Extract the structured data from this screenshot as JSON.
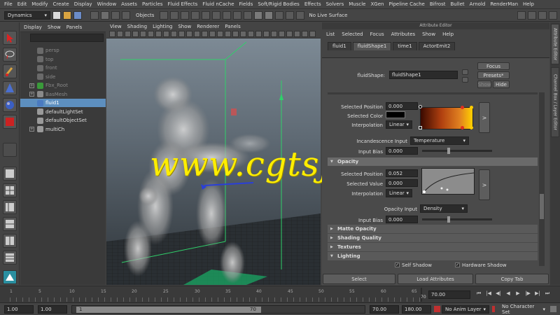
{
  "menubar": [
    "File",
    "Edit",
    "Modify",
    "Create",
    "Display",
    "Window",
    "Assets",
    "Particles",
    "Fluid Effects",
    "Fluid nCache",
    "Fields",
    "Soft/Rigid Bodies",
    "Effects",
    "Solvers",
    "Muscle",
    "XGen",
    "Pipeline Cache",
    "Bifrost",
    "Bullet",
    "Arnold",
    "RenderMan",
    "Help"
  ],
  "shelf": {
    "mode": "Dynamics",
    "objects_label": "Objects",
    "live_surface": "No Live Surface"
  },
  "outliner": {
    "menu": [
      "Display",
      "Show",
      "Panels"
    ],
    "items": [
      {
        "label": "persp",
        "dim": true,
        "expand": false
      },
      {
        "label": "top",
        "dim": true,
        "expand": false
      },
      {
        "label": "front",
        "dim": true,
        "expand": false
      },
      {
        "label": "side",
        "dim": true,
        "expand": false
      },
      {
        "label": "Fbx_Root",
        "dim": true,
        "expand": true
      },
      {
        "label": "BasMesh",
        "dim": true,
        "expand": true
      },
      {
        "label": "fluid1",
        "dim": false,
        "expand": false,
        "selected": true
      },
      {
        "label": "defaultLightSet",
        "dim": false,
        "expand": false
      },
      {
        "label": "defaultObjectSet",
        "dim": false,
        "expand": false
      },
      {
        "label": "multiCh",
        "dim": false,
        "expand": true
      }
    ]
  },
  "viewport": {
    "menu": [
      "View",
      "Shading",
      "Lighting",
      "Show",
      "Renderer",
      "Panels"
    ]
  },
  "attr_editor": {
    "title": "Attribute Editor",
    "menu": [
      "List",
      "Selected",
      "Focus",
      "Attributes",
      "Show",
      "Help"
    ],
    "tabs": [
      "fluid1",
      "fluidShape1",
      "time1",
      "ActorEmit2"
    ],
    "active_tab": 1,
    "shape_label": "fluidShape:",
    "shape_value": "fluidShape1",
    "focus": "Focus",
    "presets": "Presets*",
    "show": "Show",
    "hide": "Hide",
    "incandescence": {
      "selected_position_label": "Selected Position",
      "selected_position": "0.000",
      "selected_color_label": "Selected Color",
      "interpolation_label": "Interpolation",
      "interpolation": "Linear",
      "input_label": "Incandescence Input",
      "input": "Temperature",
      "bias_label": "Input Bias",
      "bias": "0.000",
      "expand": ">"
    },
    "opacity": {
      "section": "Opacity",
      "selected_position_label": "Selected Position",
      "selected_position": "0.052",
      "selected_value_label": "Selected Value",
      "selected_value": "0.000",
      "interpolation_label": "Interpolation",
      "interpolation": "Linear",
      "input_label": "Opacity Input",
      "input": "Density",
      "bias_label": "Input Bias",
      "bias": "0.000",
      "expand": ">"
    },
    "sections": [
      "Matte Opacity",
      "Shading Quality",
      "Textures",
      "Lighting"
    ],
    "self_shadow": "Self Shadow",
    "hardware_shadow": "Hardware Shadow",
    "buttons": [
      "Select",
      "Load Attributes",
      "Copy Tab"
    ]
  },
  "side_tabs": [
    "Attribute Editor",
    "Channel Box / Layer Editor"
  ],
  "timeline": {
    "ticks": [
      "1",
      "5",
      "10",
      "15",
      "20",
      "25",
      "30",
      "35",
      "40",
      "45",
      "50",
      "55",
      "60",
      "65",
      "70"
    ],
    "current_frame": "70.00",
    "end_marker": "70"
  },
  "range": {
    "start": "1.00",
    "start2": "1.00",
    "slider_start": "1",
    "slider_end": "70",
    "end": "70.00",
    "end2": "180.00",
    "anim_layer": "No Anim Layer",
    "char_set": "No Character Set"
  },
  "watermark": "www.cgtsj.com",
  "colors": {
    "accent": "#5c8fbf",
    "watermark": "#ffee00",
    "grid": "#22aa55"
  }
}
